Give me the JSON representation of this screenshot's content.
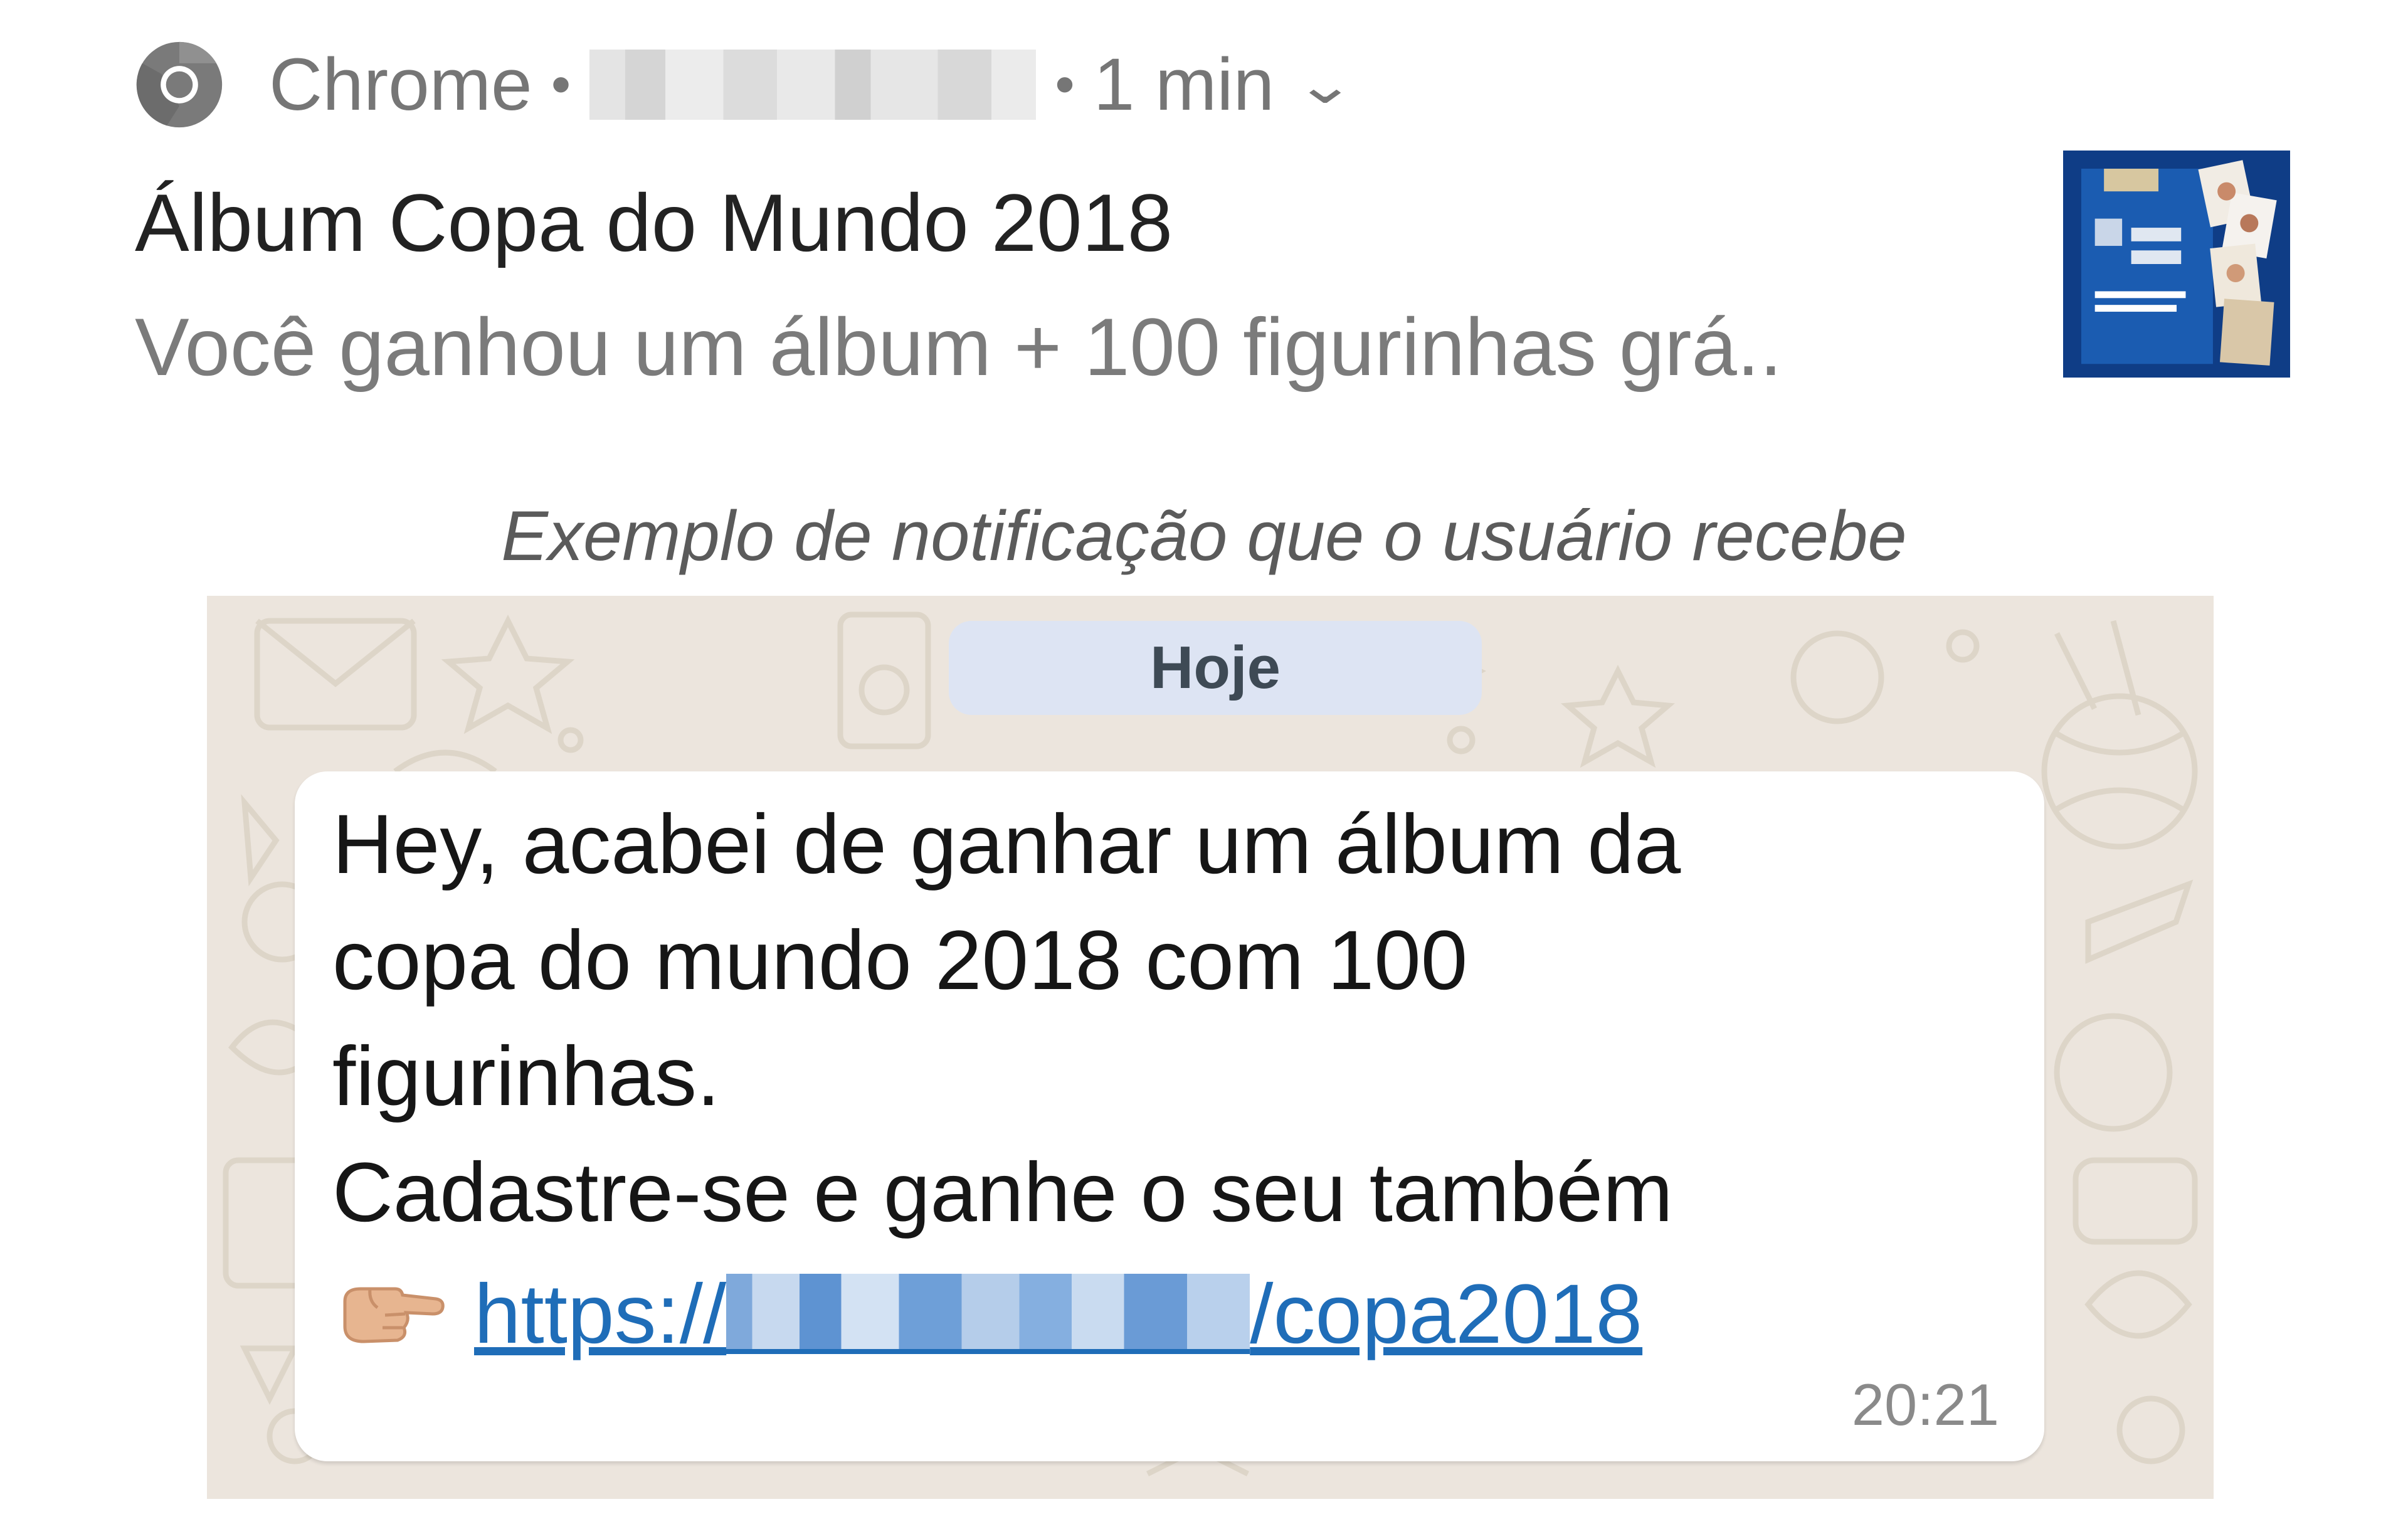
{
  "notification": {
    "app_name": "Chrome",
    "separator": "•",
    "time": "1 min",
    "title": "Álbum Copa do Mundo 2018",
    "body": "Você ganhou um álbum + 100 figurinhas grá..",
    "icons": {
      "app": "chrome-icon",
      "expand": "chevron-down-icon",
      "thumbnail": "album-thumbnail"
    }
  },
  "caption": "Exemplo de notificação que o usuário recebe",
  "chat": {
    "date_label": "Hoje",
    "message": {
      "lines": [
        "Hey, acabei de ganhar um álbum da",
        "copa do mundo 2018 com 100",
        "figurinhas.",
        "Cadastre-se e ganhe o seu também"
      ],
      "link_prefix": "https://",
      "link_suffix": "/copa2018",
      "time": "20:21",
      "emoji": "pointing-hand-icon"
    }
  },
  "colors": {
    "chat_background": "#ece5dd",
    "date_pill": "#dde4f3",
    "link": "#1f6db8",
    "thumbnail": "#0f3d86"
  }
}
